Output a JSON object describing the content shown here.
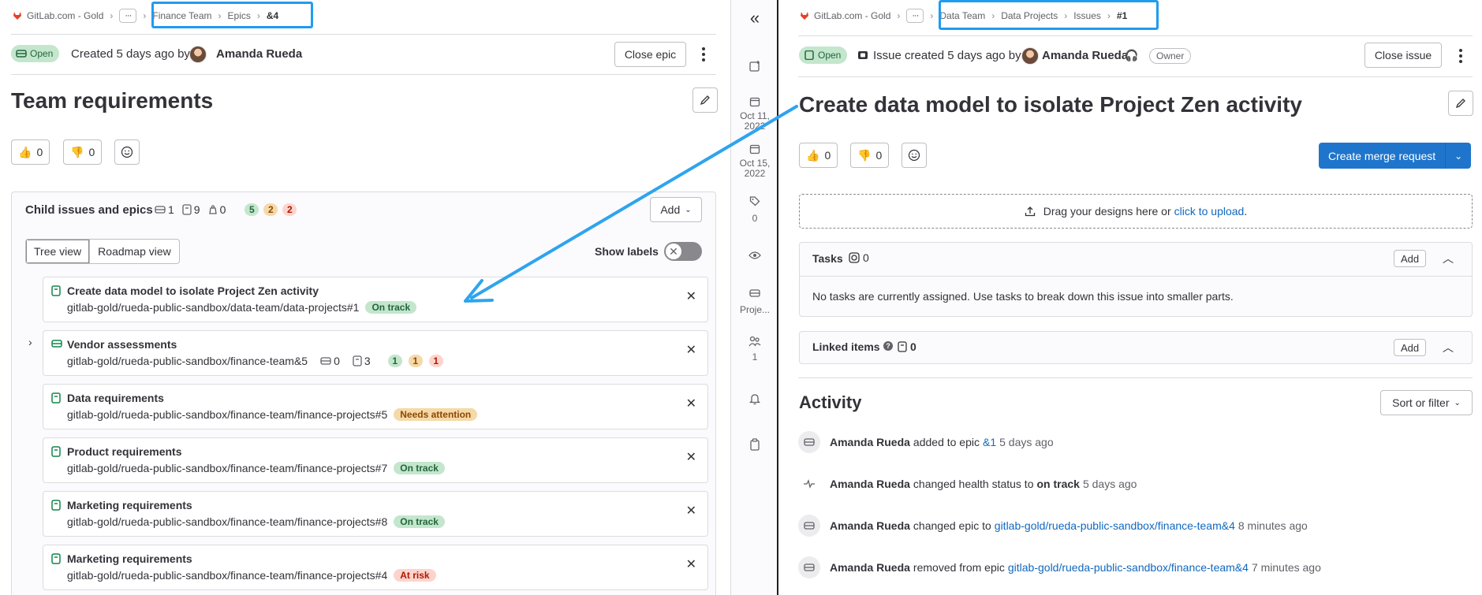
{
  "left": {
    "breadcrumb": {
      "org": "GitLab.com - Gold",
      "more": "···",
      "items": [
        "Finance Team",
        "Epics",
        "&4"
      ]
    },
    "header": {
      "status": "Open",
      "created_prefix": "Created 5 days ago by",
      "author": "Amanda Rueda",
      "close_button": "Close epic"
    },
    "title": "Team requirements",
    "reactions": {
      "thumbs_up": "0",
      "thumbs_down": "0"
    },
    "children_panel": {
      "heading": "Child issues and epics",
      "epic_count": "1",
      "issue_count": "9",
      "weight_count": "0",
      "health_on_track": "5",
      "health_needs_attention": "2",
      "health_at_risk": "2",
      "add_button": "Add",
      "view_tree": "Tree view",
      "view_roadmap": "Roadmap view",
      "show_labels": "Show labels"
    },
    "children": [
      {
        "title": "Create data model to isolate Project Zen activity",
        "path": "gitlab-gold/rueda-public-sandbox/data-team/data-projects#1",
        "status": "On track",
        "status_type": "green",
        "kind": "issue"
      },
      {
        "title": "Vendor assessments",
        "path": "gitlab-gold/rueda-public-sandbox/finance-team&5",
        "kind": "epic",
        "epic_count": "0",
        "issue_count": "3",
        "h1": "1",
        "h2": "1",
        "h3": "1"
      },
      {
        "title": "Data requirements",
        "path": "gitlab-gold/rueda-public-sandbox/finance-team/finance-projects#5",
        "status": "Needs attention",
        "status_type": "orange",
        "kind": "issue"
      },
      {
        "title": "Product requirements",
        "path": "gitlab-gold/rueda-public-sandbox/finance-team/finance-projects#7",
        "status": "On track",
        "status_type": "green",
        "kind": "issue"
      },
      {
        "title": "Marketing requirements",
        "path": "gitlab-gold/rueda-public-sandbox/finance-team/finance-projects#8",
        "status": "On track",
        "status_type": "green",
        "kind": "issue"
      },
      {
        "title": "Marketing requirements",
        "path": "gitlab-gold/rueda-public-sandbox/finance-team/finance-projects#4",
        "status": "At risk",
        "status_type": "red",
        "kind": "issue"
      }
    ]
  },
  "sidebar": {
    "collapse": "«",
    "start_date": "Oct 11, 2022",
    "due_date": "Oct 15, 2022",
    "labels_count": "0",
    "project_label": "Proje...",
    "participants_count": "1"
  },
  "right": {
    "breadcrumb": {
      "org": "GitLab.com - Gold",
      "more": "···",
      "items": [
        "Data Team",
        "Data Projects",
        "Issues",
        "#1"
      ]
    },
    "header": {
      "status": "Open",
      "created_text": "Issue created 5 days ago by",
      "author": "Amanda Rueda",
      "role": "Owner",
      "close_button": "Close issue"
    },
    "title": "Create data model to isolate Project Zen activity",
    "reactions": {
      "thumbs_up": "0",
      "thumbs_down": "0"
    },
    "merge_button": "Create merge request",
    "upload": {
      "text": "Drag your designs here or",
      "link": "click to upload",
      "end": "."
    },
    "tasks": {
      "heading": "Tasks",
      "count": "0",
      "add": "Add",
      "empty": "No tasks are currently assigned. Use tasks to break down this issue into smaller parts."
    },
    "linked": {
      "heading": "Linked items",
      "count": "0",
      "add": "Add"
    },
    "activity": {
      "heading": "Activity",
      "sort": "Sort or filter",
      "items": [
        {
          "author": "Amanda Rueda",
          "text": "added to epic",
          "link": "&1",
          "suffix": "5 days ago"
        },
        {
          "author": "Amanda Rueda",
          "text": "changed health status to",
          "bold": "on track",
          "suffix": "5 days ago"
        },
        {
          "author": "Amanda Rueda",
          "text": "changed epic to",
          "link": "gitlab-gold/rueda-public-sandbox/finance-team&4",
          "suffix": "8 minutes ago"
        },
        {
          "author": "Amanda Rueda",
          "text": "removed from epic",
          "link": "gitlab-gold/rueda-public-sandbox/finance-team&4",
          "suffix": "7 minutes ago"
        }
      ]
    }
  },
  "colors": {
    "highlight": "#1f9cf0",
    "arrow": "#2ea4ee",
    "primary": "#1f75cb",
    "on_track": "#c3e6cd",
    "needs_attention": "#f5d9a8",
    "at_risk": "#fdd4cd"
  }
}
